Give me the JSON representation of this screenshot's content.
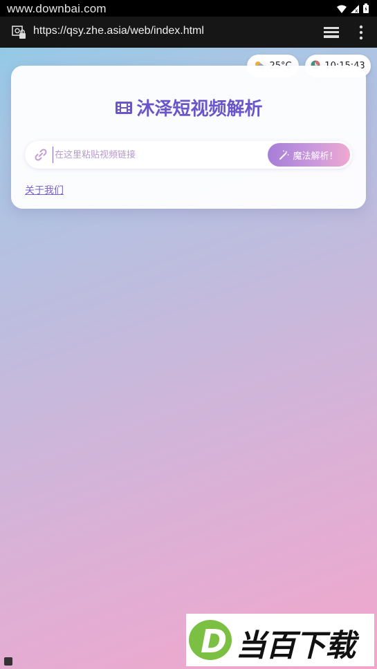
{
  "status_bar": {
    "watermark": "www.downbai.com"
  },
  "browser": {
    "url": "https://qsy.zhe.asia/web/index.html"
  },
  "widgets": {
    "temperature": "25°C",
    "time": "10:15:43"
  },
  "card": {
    "title": "沐泽短视频解析",
    "input_placeholder": "在这里粘贴视频链接",
    "parse_button_label": "魔法解析！",
    "about_link": "关于我们"
  },
  "brand": {
    "letter": "D",
    "name": "当百下载"
  },
  "icons": [
    "lock-icon",
    "tabs-icon",
    "menu-icon",
    "weather-icon",
    "clock-icon",
    "film-icon",
    "link-icon",
    "wand-icon"
  ],
  "colors": {
    "accent": "#6a55c9",
    "button_gradient_start": "#a77ed8",
    "button_gradient_end": "#f0a8cf",
    "brand_green": "#7bc043"
  }
}
